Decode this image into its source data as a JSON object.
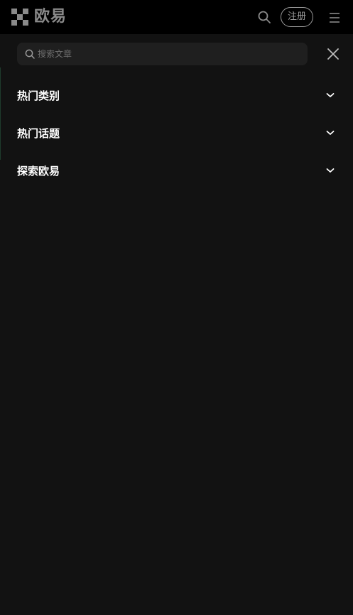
{
  "header": {
    "brand_name": "欧易",
    "register_label": "注册",
    "icons": [
      "okx-logo-icon",
      "search-icon",
      "hamburger-menu-icon"
    ]
  },
  "search": {
    "placeholder": "搜索文章",
    "icons": [
      "search-icon",
      "close-icon"
    ]
  },
  "menu": {
    "items": [
      {
        "label": "热门类别",
        "icon": "chevron-down-icon"
      },
      {
        "label": "热门话题",
        "icon": "chevron-down-icon"
      },
      {
        "label": "探索欧易",
        "icon": "chevron-down-icon"
      }
    ]
  },
  "colors": {
    "page_background": "#121212",
    "header_background": "#000000",
    "search_background": "#1f1f1f",
    "text_primary": "#ffffff",
    "text_muted": "#8a8a8a"
  }
}
